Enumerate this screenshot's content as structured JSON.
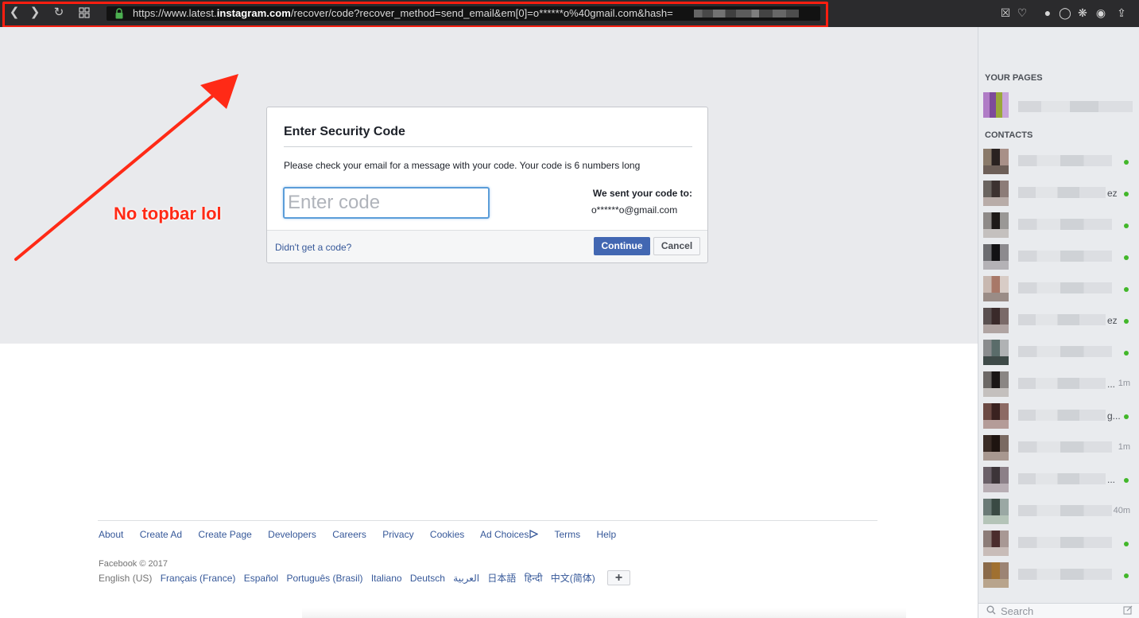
{
  "browser": {
    "url_host_prefix": "https://www.latest.",
    "url_host_bold": "instagram.com",
    "url_path": "/recover/code?recover_method=send_email&em[0]=o******o%40gmail.com&hash=",
    "highlight_color": "#ff1e10"
  },
  "dialog": {
    "title": "Enter Security Code",
    "description": "Please check your email for a message with your code. Your code is 6 numbers long",
    "input_placeholder": "Enter code",
    "input_value": "",
    "sent_label": "We sent your code to:",
    "sent_email": "o******o@gmail.com",
    "no_code_link": "Didn't get a code?",
    "continue_label": "Continue",
    "cancel_label": "Cancel"
  },
  "annotation": {
    "text": "No topbar lol",
    "color": "#ff2a16"
  },
  "footer": {
    "links": [
      "About",
      "Create Ad",
      "Create Page",
      "Developers",
      "Careers",
      "Privacy",
      "Cookies",
      "Ad Choices",
      "Terms",
      "Help"
    ],
    "copyright": "Facebook © 2017",
    "current_language": "English (US)",
    "languages": [
      "Français (France)",
      "Español",
      "Português (Brasil)",
      "Italiano",
      "Deutsch",
      "العربية",
      "日本語",
      "हिन्दी",
      "中文(简体)"
    ],
    "more_label": "+"
  },
  "sidebar": {
    "your_pages_heading": "YOUR PAGES",
    "contacts_heading": "CONTACTS",
    "contacts": [
      {
        "suffix": "",
        "status": "online",
        "time": ""
      },
      {
        "suffix": "ez",
        "status": "online",
        "time": ""
      },
      {
        "suffix": "",
        "status": "online",
        "time": ""
      },
      {
        "suffix": "",
        "status": "online",
        "time": ""
      },
      {
        "suffix": "",
        "status": "online",
        "time": ""
      },
      {
        "suffix": "ez",
        "status": "online",
        "time": ""
      },
      {
        "suffix": "",
        "status": "online",
        "time": ""
      },
      {
        "suffix": "...",
        "status": "idle",
        "time": "1m"
      },
      {
        "suffix": "g...",
        "status": "online",
        "time": ""
      },
      {
        "suffix": "",
        "status": "idle",
        "time": "1m"
      },
      {
        "suffix": "...",
        "status": "online",
        "time": ""
      },
      {
        "suffix": "",
        "status": "idle",
        "time": "40m"
      },
      {
        "suffix": "",
        "status": "online",
        "time": ""
      },
      {
        "suffix": "",
        "status": "online",
        "time": ""
      }
    ],
    "search_placeholder": "Search"
  }
}
